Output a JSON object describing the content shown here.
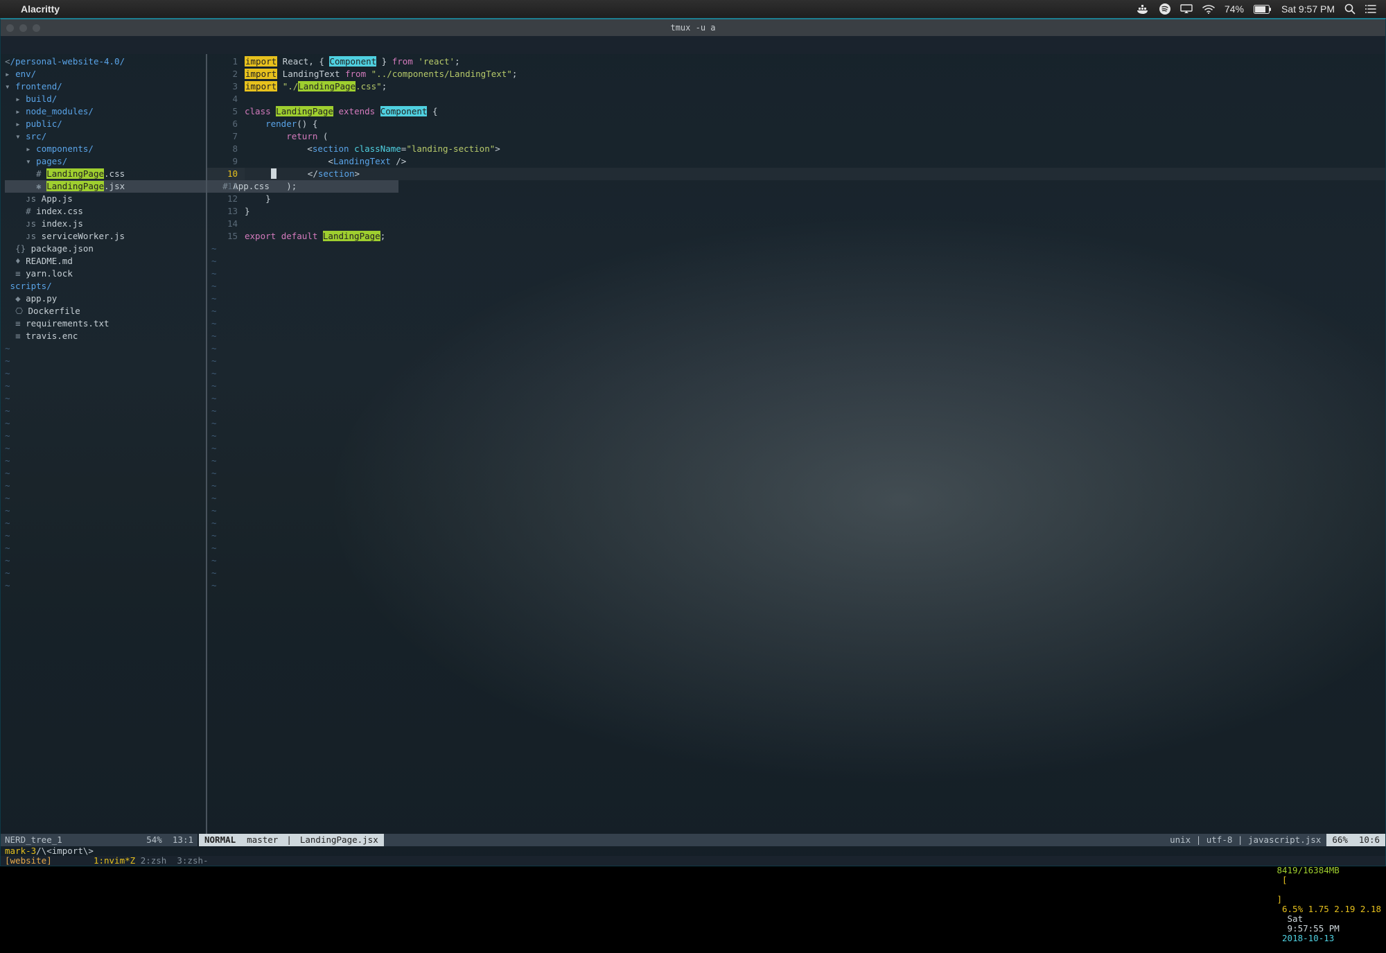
{
  "menubar": {
    "app_name": "Alacritty",
    "battery_pct": "74%",
    "clock": "Sat 9:57 PM"
  },
  "window": {
    "title": "tmux -u a"
  },
  "tree": {
    "root": "/personal-website-4.0/",
    "items": [
      {
        "indent": 0,
        "icon": "▸",
        "label": "env/",
        "cls": "b"
      },
      {
        "indent": 0,
        "icon": "▾",
        "label": "frontend/",
        "cls": "b"
      },
      {
        "indent": 1,
        "icon": "▸",
        "label": "build/",
        "cls": "b"
      },
      {
        "indent": 1,
        "icon": "▸",
        "label": "node_modules/",
        "cls": "b"
      },
      {
        "indent": 1,
        "icon": "▸",
        "label": "public/",
        "cls": "b"
      },
      {
        "indent": 1,
        "icon": "▾",
        "label": "src/",
        "cls": "b"
      },
      {
        "indent": 2,
        "icon": "▸",
        "label": "components/",
        "cls": "b"
      },
      {
        "indent": 2,
        "icon": "▾",
        "label": "pages/",
        "cls": "b"
      },
      {
        "indent": 3,
        "icon": "#",
        "label_hl": "LandingPage",
        "label_sfx": ".css",
        "cls": "w"
      },
      {
        "indent": 3,
        "icon": "✱",
        "label_hl": "LandingPage",
        "label_sfx": ".jsx",
        "cls": "w",
        "selected": true
      },
      {
        "indent": 2,
        "icon": "#",
        "label": "App.css",
        "cls": "w",
        "selected": true
      },
      {
        "indent": 2,
        "icon": "ᴊs",
        "label": "App.js",
        "cls": "w"
      },
      {
        "indent": 2,
        "icon": "#",
        "label": "index.css",
        "cls": "w"
      },
      {
        "indent": 2,
        "icon": "ᴊs",
        "label": "index.js",
        "cls": "w"
      },
      {
        "indent": 2,
        "icon": "ᴊs",
        "label": "serviceWorker.js",
        "cls": "w"
      },
      {
        "indent": 1,
        "icon": "{}",
        "label": "package.json",
        "cls": "w"
      },
      {
        "indent": 1,
        "icon": "♦",
        "label": "README.md",
        "cls": "w"
      },
      {
        "indent": 1,
        "icon": "≡",
        "label": "yarn.lock",
        "cls": "w"
      },
      {
        "indent": 0,
        "icon": "",
        "label": "scripts/",
        "cls": "b"
      },
      {
        "indent": 1,
        "icon": "◆",
        "label": "app.py",
        "cls": "w"
      },
      {
        "indent": 1,
        "icon": "⎔",
        "label": "Dockerfile",
        "cls": "w"
      },
      {
        "indent": 1,
        "icon": "≡",
        "label": "requirements.txt",
        "cls": "w"
      },
      {
        "indent": 1,
        "icon": "≡",
        "label": "travis.enc",
        "cls": "w"
      }
    ],
    "status": {
      "name": "NERD_tree_1",
      "pct": "54%",
      "pos": "13:1"
    }
  },
  "editor": {
    "lines": [
      {
        "n": 1,
        "tokens": [
          [
            "imp",
            "import"
          ],
          [
            "pun",
            " React, { "
          ],
          [
            "cmp",
            "Component"
          ],
          [
            "pun",
            " } "
          ],
          [
            "kw",
            "from"
          ],
          [
            "pun",
            " "
          ],
          [
            "str",
            "'react'"
          ],
          [
            "pun",
            ";"
          ]
        ]
      },
      {
        "n": 2,
        "tokens": [
          [
            "imp",
            "import"
          ],
          [
            "pun",
            " LandingText "
          ],
          [
            "kw",
            "from"
          ],
          [
            "pun",
            " "
          ],
          [
            "str",
            "\"../components/LandingText\""
          ],
          [
            "pun",
            ";"
          ]
        ]
      },
      {
        "n": 3,
        "tokens": [
          [
            "imp",
            "import"
          ],
          [
            "pun",
            " "
          ],
          [
            "str",
            "\"./"
          ],
          [
            "cls",
            "LandingPage"
          ],
          [
            "str",
            ".css\""
          ],
          [
            "pun",
            ";"
          ]
        ]
      },
      {
        "n": 4,
        "tokens": []
      },
      {
        "n": 5,
        "tokens": [
          [
            "kw",
            "class"
          ],
          [
            "pun",
            " "
          ],
          [
            "cls",
            "LandingPage"
          ],
          [
            "pun",
            " "
          ],
          [
            "kw",
            "extends"
          ],
          [
            "pun",
            " "
          ],
          [
            "cmp",
            "Component"
          ],
          [
            "pun",
            " {"
          ]
        ]
      },
      {
        "n": 6,
        "tokens": [
          [
            "pun",
            "    "
          ],
          [
            "fn",
            "render"
          ],
          [
            "pun",
            "() {"
          ]
        ]
      },
      {
        "n": 7,
        "tokens": [
          [
            "pun",
            "        "
          ],
          [
            "kw",
            "return"
          ],
          [
            "pun",
            " ("
          ]
        ]
      },
      {
        "n": 8,
        "tokens": [
          [
            "pun",
            "            <"
          ],
          [
            "tag",
            "section"
          ],
          [
            "pun",
            " "
          ],
          [
            "attr",
            "className"
          ],
          [
            "pun",
            "="
          ],
          [
            "str",
            "\"landing-section\""
          ],
          [
            "pun",
            ">"
          ]
        ]
      },
      {
        "n": 9,
        "tokens": [
          [
            "pun",
            "                <"
          ],
          [
            "tag",
            "LandingText"
          ],
          [
            "pun",
            " />"
          ]
        ]
      },
      {
        "n": 10,
        "cur": true,
        "tokens": [
          [
            "pun",
            "     "
          ],
          [
            "cursor",
            ""
          ],
          [
            "pun",
            "      </"
          ],
          [
            "tag",
            "section"
          ],
          [
            "pun",
            ">"
          ]
        ]
      },
      {
        "n": 11,
        "tokens": [
          [
            "pun",
            "        );"
          ]
        ]
      },
      {
        "n": 12,
        "tokens": [
          [
            "pun",
            "    }"
          ]
        ]
      },
      {
        "n": 13,
        "tokens": [
          [
            "pun",
            "}"
          ]
        ]
      },
      {
        "n": 14,
        "tokens": []
      },
      {
        "n": 15,
        "tokens": [
          [
            "kw",
            "export"
          ],
          [
            "pun",
            " "
          ],
          [
            "kw",
            "default"
          ],
          [
            "pun",
            " "
          ],
          [
            "cls",
            "LandingPage"
          ],
          [
            "pun",
            ";"
          ]
        ]
      }
    ],
    "status": {
      "mode": "NORMAL",
      "branch": "master",
      "file": "LandingPage.jsx",
      "info": "unix | utf-8 | javascript.jsx",
      "pct": "66%",
      "pos": "10:6"
    }
  },
  "cmdline": {
    "text": "mark-3",
    "pattern": "/\\<import\\>"
  },
  "tmux": {
    "session": "[website]",
    "win_cur": "1:nvim*Z",
    "win_rest": " 2:zsh  3:zsh-",
    "mem": "8419/16384MB",
    "brackets_l": "[",
    "brackets_r": "]",
    "cpu": " 6.5% 1.75 2.19 2.18",
    "day": "Sat",
    "time": " 9:57:55 PM",
    "date": "2018-10-13"
  }
}
